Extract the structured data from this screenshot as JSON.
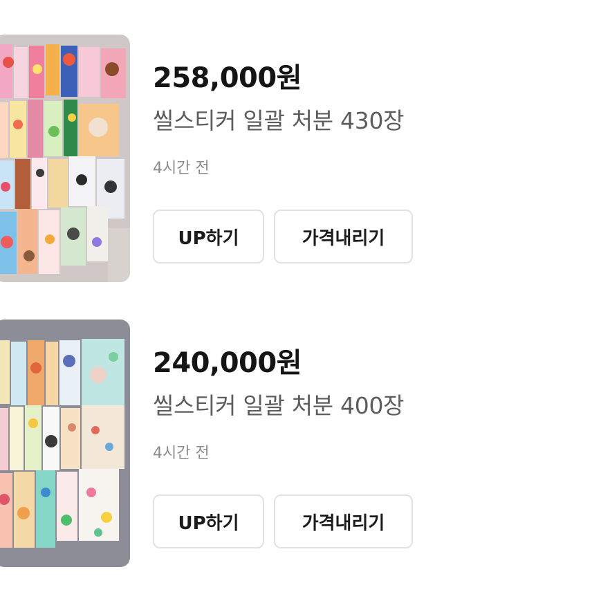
{
  "listings": [
    {
      "price": "258,000원",
      "title": "씰스티커 일괄 처분 430장",
      "time": "4시간 전",
      "up_label": "UP하기",
      "price_down_label": "가격내리기",
      "thumbnail_background": "#cfc8c6"
    },
    {
      "price": "240,000원",
      "title": "씰스티커 일괄 처분 400장",
      "time": "4시간 전",
      "up_label": "UP하기",
      "price_down_label": "가격내리기",
      "thumbnail_background": "#8c8d96"
    }
  ],
  "colors": {
    "price_text": "#151515",
    "title_text": "#5c5c5c",
    "time_text": "#8c8c8c",
    "button_border": "#e2e2e2"
  }
}
